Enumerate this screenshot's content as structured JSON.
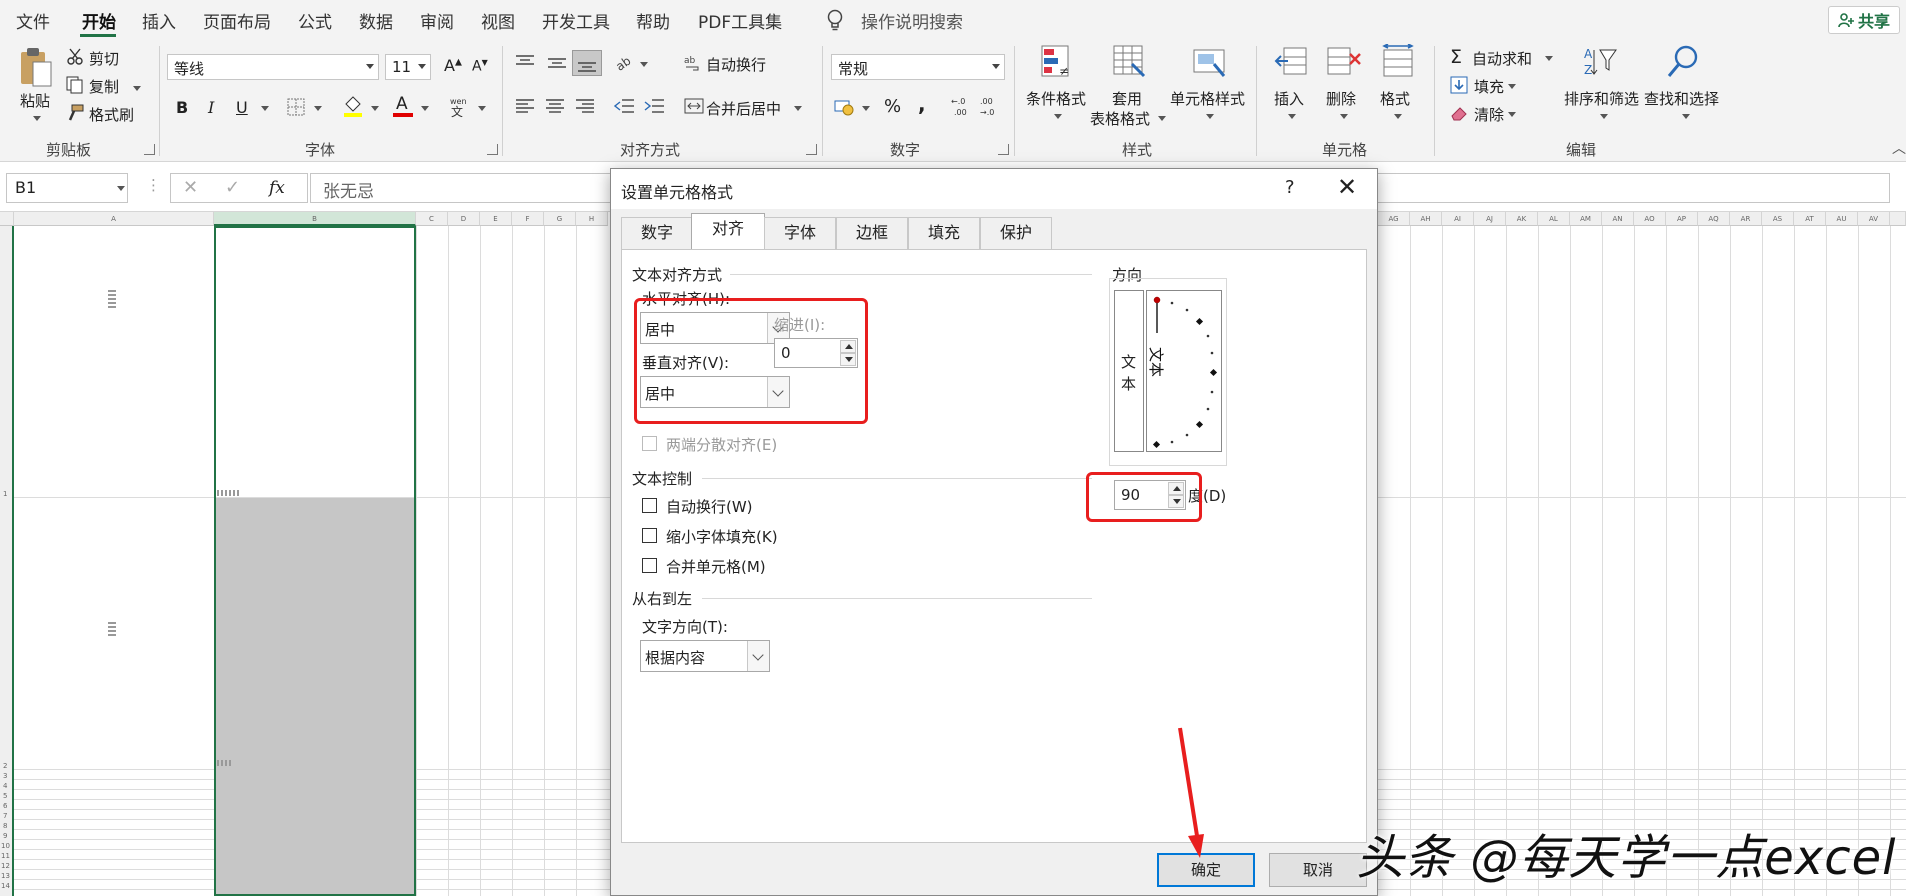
{
  "menu": {
    "items": [
      "文件",
      "开始",
      "插入",
      "页面布局",
      "公式",
      "数据",
      "审阅",
      "视图",
      "开发工具",
      "帮助",
      "PDF工具集"
    ],
    "tell_me": "操作说明搜索",
    "share": "共享"
  },
  "ribbon": {
    "clipboard": {
      "paste": "粘贴",
      "cut": "剪切",
      "copy": "复制",
      "format_painter": "格式刷",
      "label": "剪贴板"
    },
    "font": {
      "name": "等线",
      "size": "11",
      "bold": "B",
      "italic": "I",
      "underline": "U",
      "font_color_glyph": "A",
      "label": "字体"
    },
    "alignment": {
      "wrap_text": "自动换行",
      "merge_center": "合并后居中",
      "label": "对齐方式"
    },
    "number": {
      "format": "常规",
      "percent": "%",
      "comma": ",",
      "label": "数字"
    },
    "styles": {
      "conditional": "条件格式",
      "table_line1": "套用",
      "table_line2": "表格格式",
      "cell_styles": "单元格样式",
      "label": "样式"
    },
    "cells": {
      "insert": "插入",
      "delete": "删除",
      "format": "格式",
      "label": "单元格"
    },
    "editing": {
      "autosum": "自动求和",
      "fill": "填充",
      "clear": "清除",
      "sort_filter": "排序和筛选",
      "find_select": "查找和选择",
      "label": "编辑"
    }
  },
  "formula_bar": {
    "name_box": "B1",
    "fx": "fx",
    "content": "张无忌"
  },
  "sheet": {
    "left_columns": [
      "A",
      "B",
      "C",
      "D",
      "E",
      "F",
      "G",
      "H"
    ],
    "right_columns": [
      "AG",
      "AH",
      "AI",
      "AJ",
      "AK",
      "AL",
      "AM",
      "AN",
      "AO",
      "AP",
      "AQ",
      "AR",
      "AS",
      "AT",
      "AU",
      "AV"
    ],
    "row_numbers": [
      "1",
      "2",
      "3",
      "4",
      "5",
      "6",
      "7",
      "8",
      "9",
      "10",
      "11",
      "12",
      "13",
      "14"
    ]
  },
  "dialog": {
    "title": "设置单元格格式",
    "help": "?",
    "close": "✕",
    "tabs": [
      "数字",
      "对齐",
      "字体",
      "边框",
      "填充",
      "保护"
    ],
    "active_tab": "对齐",
    "text_alignment_section": "文本对齐方式",
    "horizontal_label": "水平对齐(H):",
    "horizontal_value": "居中",
    "indent_label": "缩进(I):",
    "indent_value": "0",
    "vertical_label": "垂直对齐(V):",
    "vertical_value": "居中",
    "justify_distributed": "两端分散对齐(E)",
    "text_control_section": "文本控制",
    "wrap_text": "自动换行(W)",
    "shrink_to_fit": "缩小字体填充(K)",
    "merge_cells": "合并单元格(M)",
    "rtl_section": "从右到左",
    "text_direction_label": "文字方向(T):",
    "text_direction_value": "根据内容",
    "orientation_section": "方向",
    "vertical_text_1": "文",
    "vertical_text_2": "本",
    "dial_text": "文本",
    "degrees_value": "90",
    "degrees_label": "度(D)",
    "ok": "确定",
    "cancel": "取消"
  },
  "watermark": "头条 @每天学一点excel",
  "colors": {
    "excel_green": "#217346",
    "highlight_red": "#e81e1e",
    "focus_blue": "#0078d7"
  }
}
